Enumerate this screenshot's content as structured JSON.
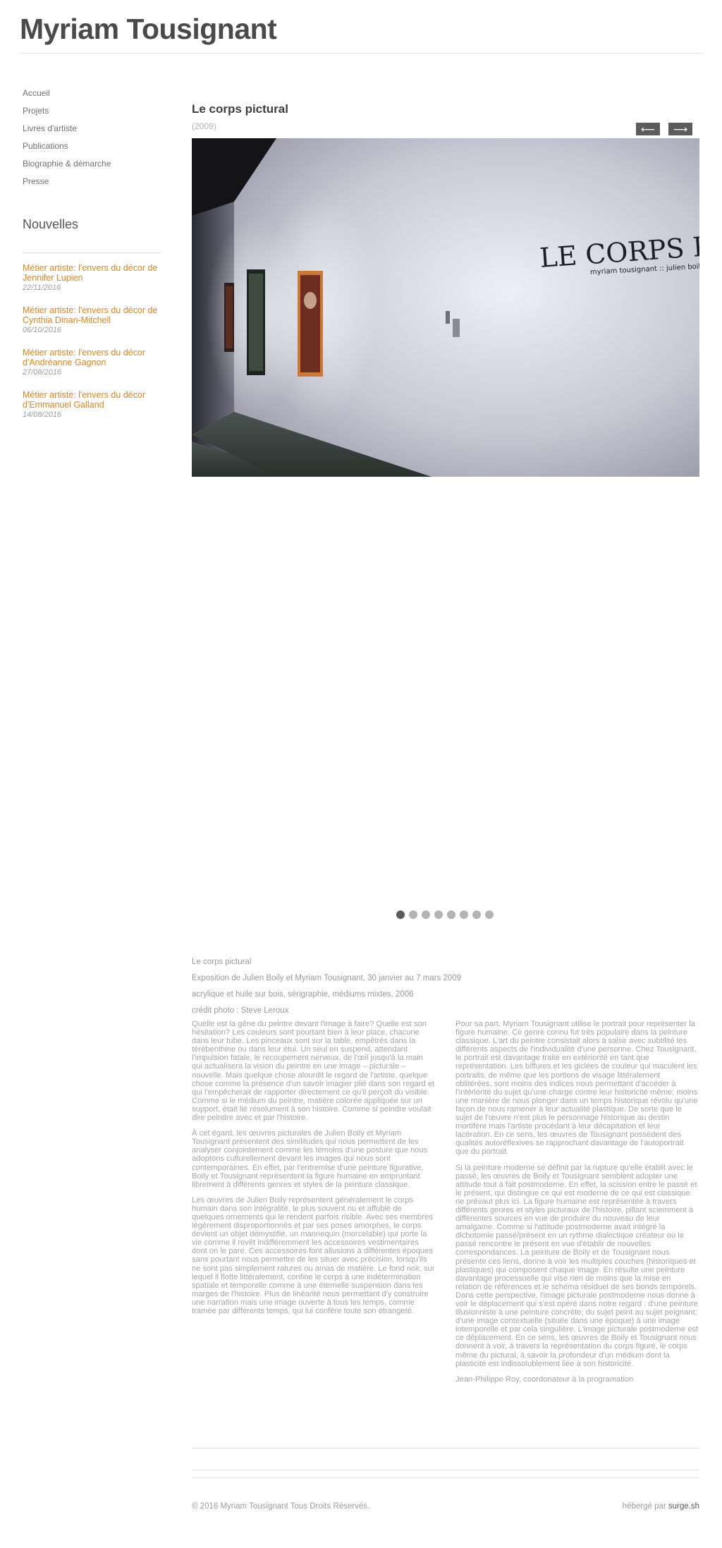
{
  "site": {
    "title": "Myriam Tousignant"
  },
  "nav": [
    {
      "label": "Accueil"
    },
    {
      "label": "Projets"
    },
    {
      "label": "Livres d'artiste"
    },
    {
      "label": "Publications"
    },
    {
      "label": "Biographie & démarche"
    },
    {
      "label": "Presse"
    }
  ],
  "news": {
    "heading": "Nouvelles",
    "items": [
      {
        "title": "Métier artiste: l'envers du décor de Jennifer Lupien",
        "date": "22/11/2016"
      },
      {
        "title": "Métier artiste: l'envers du décor de Cynthia Dinan-Mitchell",
        "date": "06/10/2016"
      },
      {
        "title": "Métier artiste: l'envers du décor d'Andréanne Gagnon",
        "date": "27/08/2016"
      },
      {
        "title": "Métier artiste: l'envers du décor d'Emmanuel Galland",
        "date": "14/08/2016"
      }
    ]
  },
  "project": {
    "title": "Le corps pictural",
    "year": "(2009)",
    "prev_label": "⟵",
    "next_label": "⟶",
    "wall_text_main": "LE CORPS PICTURAL",
    "wall_text_sub": "myriam tousignant :: julien boily",
    "slide_count": 8,
    "active_slide": 1
  },
  "info": {
    "line1": "Le corps pictural",
    "line2": "Exposition de Julien Boily et Myriam Tousignant, 30 janvier au 7 mars 2009",
    "line3": "acrylique et huile sur bois, sérigraphie, médiums mixtes, 2006",
    "line4": "crédit photo : Steve Leroux"
  },
  "text": {
    "left_p1": "Quelle est la gêne du peintre devant l'image à faire? Quelle est son hésitation? Les couleurs sont pourtant bien à leur place, chacune dans leur tube. Les pinceaux sont sur la table, empêtrés dans la térébenthine ou dans leur étui. Un seul en suspend, attendant l'impulsion fatale, le recoupement nerveux, de l'œil jusqu'à la main qui actualisera la vision du peintre en une image – picturale – nouvelle. Mais quelque chose alourdit le regard de l'artiste, quelque chose comme la présence d'un savoir imagier plié dans son regard et qui l'empêcherait de rapporter directement ce qu'il perçoit du visible. Comme si le médium du peintre, matière colorée appliquée sur un support, était lié résolument à son histoire. Comme si peindre voulait dire peindre avec et par l'histoire.",
    "left_p2": "À cet égard, les œuvres picturales de Julien Boily et Myriam Tousignant présentent des similitudes qui nous permettent de les analyser conjointement comme les témoins d'une posture que nous adoptons culturellement devant les images qui nous sont contemporaines. En effet, par l'entremise d'une peinture figurative, Boily et Tousignant représentent la figure humaine en empruntant librement à différents genres et styles de la peinture classique.",
    "left_p3": "Les œuvres de Julien Boily représentent généralement le corps humain dans son intégralité, le plus souvent nu et affublé de quelques ornements qui le rendent parfois risible. Avec ses membres légèrement disproportionnés et par ses poses amorphes, le corps devient un objet démystifié, un mannequin (morcelable) qui porte la vie comme il revêt indifféremment les accessoires vestimentaires dont on le pare. Ces accessoires font allusions à différentes époques sans pourtant nous permettre de les situer avec précision, lorsqu'ils ne sont pas simplement ratures ou amas de matière. Le fond noir, sur lequel il flotte littéralement, confine le corps à une indétermination spatiale et temporelle comme à une éternelle suspension dans les marges de l'histoire. Plus de linéarité nous permettant d'y construire une narration mais une image ouverte à tous les temps, comme tramée par différents temps, qui lui confère toute son étrangeté.",
    "right_p1": "Pour sa part, Myriam Tousignant utilise le portrait pour représenter la figure humaine. Ce genre connu fut très populaire dans la peinture classique. L'art du peintre consistait alors à saisir avec subtilité les différents aspects de l'individualité d'une personne. Chez Tousignant, le portrait est davantage traité en extériorité en tant que représentation. Les biffures et les giclées de couleur qui maculent les portraits, de même que les portions de visage littéralement oblitérées, sont moins des indices nous permettant d'accéder à l'intériorité du sujet qu'une charge contre leur historicité même; moins une manière de nous plonger dans un temps historique révolu qu'une façon de nous ramener à leur actualité plastique. De sorte que le sujet de l'œuvre n'est plus le personnage historique au destin mortifère mais l'artiste procédant à leur décapitation et leur lacération. En ce sens, les œuvres de Tousignant possèdent des qualités autoréflexives se rapprochant davantage de l'autoportrait que du portrait.",
    "right_p2": "Si la peinture moderne se définit par la rupture qu'elle établit avec le passé, les œuvres de Boily et Tousignant semblent adopter une attitude tout à fait postmoderne. En effet, la scission entre le passé et le présent, qui distingue ce qui est moderne de ce qui est classique ne prévaut plus ici. La figure humaine est représentée à travers différents genres et styles picturaux de l'histoire, pillant sciemment à différentes sources en vue de produire du nouveau de leur amalgame. Comme si l'attitude postmoderne avait intégré la dichotomie passé/présent en un rythme dialectique créateur où le passé rencontre le présent en vue d'établir de nouvelles correspondances. La peinture de Boily et de Tousignant nous présente ces liens, donne à voir les multiples couches (historiques et plastiques) qui composent chaque image. En résulte une peinture davantage processuelle qui vise rien de moins que la mise en relation de références et le schéma résiduel de ses bonds temporels. Dans cette perspective, l'image picturale postmoderne nous donne à voir le déplacement qui s'est opéré dans notre regard : d'une peinture illusionniste à une peinture concrète; du sujet peint au sujet peignant; d'une image contextuelle (située dans une époque) à une image intemporelle et par cela singulière. L'image picturale postmoderne est ce déplacement. En ce sens, les œuvres de Boily et Tousignant nous donnent à voir, à travers la représentation du corps figuré, le corps même du pictural, à savoir la profondeur d'un médium dont la plasticité est indissolublement liée à son historicité.",
    "signature": "Jean-Philippe Roy, coordonateur à la programation"
  },
  "footer": {
    "copyright": "© 2016 Myriam Tousignant Tous Droits Réservés.",
    "hosted_prefix": "hébergé par ",
    "hosted_link": "surge.sh"
  },
  "colors": {
    "accent": "#e0851a",
    "button": "#5c5c5c",
    "dot_active": "#5a5a5a",
    "dot": "#b3b3b3"
  }
}
